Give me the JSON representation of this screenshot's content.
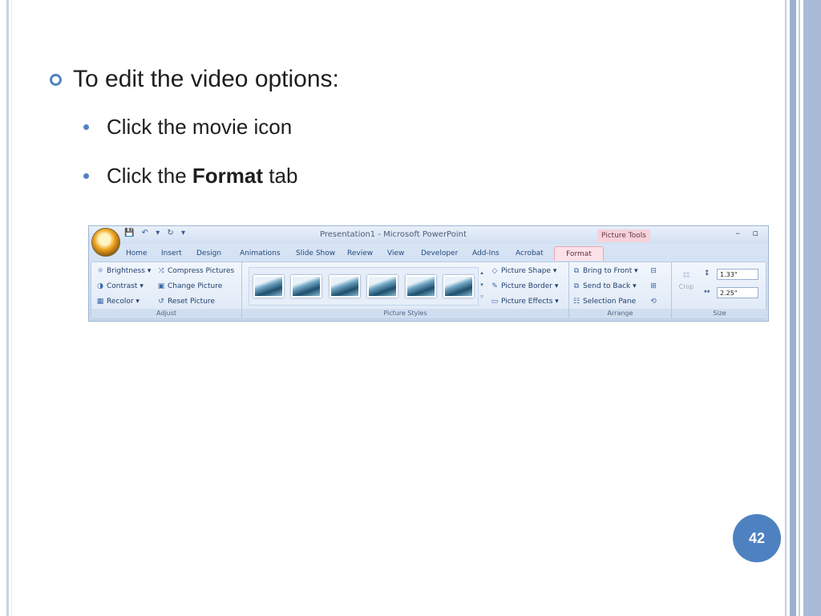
{
  "slide": {
    "heading": "To edit the video options:",
    "bullets": [
      {
        "pre": "Click the movie icon",
        "bold": "",
        "post": ""
      },
      {
        "pre": "Click the ",
        "bold": "Format",
        "post": " tab"
      }
    ],
    "page_number": "42"
  },
  "ribbon": {
    "app_title": "Presentation1 - Microsoft PowerPoint",
    "context_label": "Picture Tools",
    "tabs": [
      "Home",
      "Insert",
      "Design",
      "Animations",
      "Slide Show",
      "Review",
      "View",
      "Developer",
      "Add-Ins",
      "Acrobat",
      "Format"
    ],
    "active_tab": "Format",
    "adjust": {
      "label": "Adjust",
      "brightness": "Brightness",
      "contrast": "Contrast",
      "recolor": "Recolor",
      "compress": "Compress Pictures",
      "change": "Change Picture",
      "reset": "Reset Picture"
    },
    "styles": {
      "label": "Picture Styles",
      "shape": "Picture Shape",
      "border": "Picture Border",
      "effects": "Picture Effects"
    },
    "arrange": {
      "label": "Arrange",
      "bring_front": "Bring to Front",
      "send_back": "Send to Back",
      "selection_pane": "Selection Pane"
    },
    "size": {
      "label": "Size",
      "crop": "Crop",
      "height": "1.33\"",
      "width": "2.25\""
    }
  },
  "colors": {
    "accent": "#4e81c0",
    "bullet": "#5383bf",
    "active_tab": "#fbe2e8"
  }
}
